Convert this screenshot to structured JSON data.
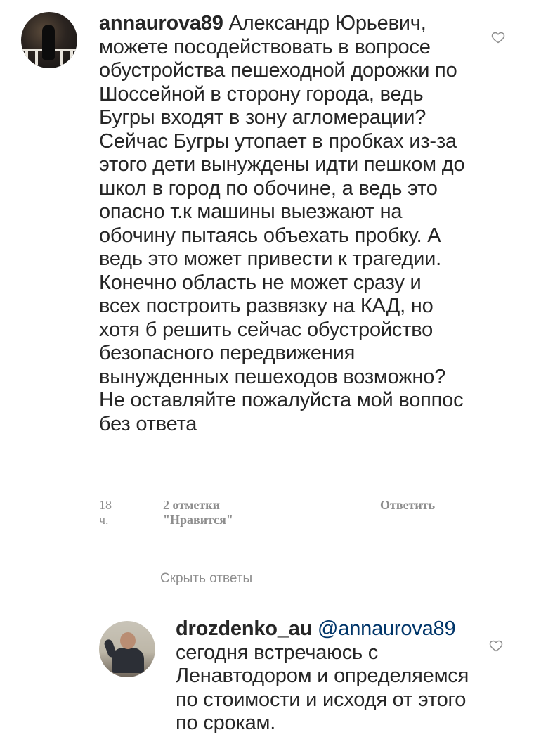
{
  "comments": [
    {
      "username": "annaurova89",
      "text": "Александр Юрьевич, можете посодействовать в вопросе обустройства пешеходной дорожки по  Шоссейной в сторону города, ведь Бугры входят в зону агломерации? Сейчас Бугры утопает в пробках  из-за этого дети вынуждены идти пешком до школ в город по обочине, а ведь это опасно т.к машины выезжают на обочину пытаясь объехать пробку. А ведь это может привести к трагедии. Конечно область не может сразу и всех построить развязку на КАД, но хотя б решить сейчас обустройство безопасного передвижения вынужденных пешеходов возможно? Не оставляйте пожалуйста мой воппос без ответа",
      "time": "18 ч.",
      "likes": "2 отметки \"Нравится\"",
      "reply": "Ответить",
      "avatar_icon": "user-avatar",
      "like_icon": "heart-outline-icon"
    },
    {
      "username": "drozdenko_au",
      "mention": "@annaurova89",
      "text": "сегодня встречаюсь с Ленавтодором и определяемся по стоимости и исходя от этого по срокам.",
      "avatar_icon": "user-avatar",
      "like_icon": "heart-outline-icon"
    }
  ],
  "hide_replies": "Скрыть ответы",
  "colors": {
    "text": "#262626",
    "secondary": "#8e8e8e",
    "mention": "#003569",
    "divider": "#c7c7c7"
  }
}
